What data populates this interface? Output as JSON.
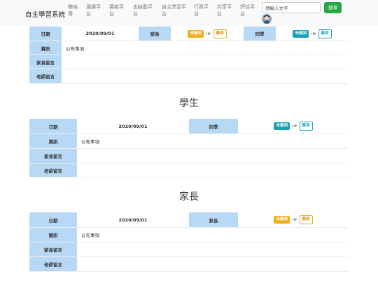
{
  "navbar": {
    "brand": "自主學習系統",
    "items": [
      {
        "line1": "聯絡",
        "line2": "簿"
      },
      {
        "line1": "選課平",
        "line2": "台"
      },
      {
        "line1": "募款平",
        "line2": "台"
      },
      {
        "line1": "出缺勤平",
        "line2": "台"
      },
      {
        "line1": "自主學習平",
        "line2": "台"
      },
      {
        "line1": "行政平",
        "line2": "台"
      },
      {
        "line1": "共享平",
        "line2": "台"
      },
      {
        "line1": "評估平",
        "line2": "台"
      }
    ],
    "search_placeholder": "請輸入文字",
    "search_button": "搜尋"
  },
  "top_block": {
    "date_label": "日期",
    "date_value": "2020/09/01",
    "parent_label": "家長",
    "parent_status": {
      "from": "未簽到",
      "to": "簽到"
    },
    "peer_label": "同學",
    "peer_status": {
      "from": "未簽到",
      "to": "簽到"
    },
    "info_label": "資訊",
    "info_value": "公布事項",
    "parent_msg_label": "家長留言",
    "teacher_msg_label": "老師留言"
  },
  "student_section": {
    "title": "學生",
    "date_label": "日期",
    "date_value": "2020/09/01",
    "peer_label": "同學",
    "peer_status": {
      "from": "未簽到",
      "to": "簽到"
    },
    "info_label": "資訊",
    "info_value": "公布事項",
    "parent_msg_label": "家長留言",
    "teacher_msg_label": "老師留言"
  },
  "parent_section": {
    "title": "家長",
    "date_label": "日期",
    "date_value": "2020/09/01",
    "parent_label": "家長",
    "parent_status": {
      "from": "未簽到",
      "to": "簽到"
    },
    "info_label": "資訊",
    "info_value": "公布事項",
    "parent_msg_label": "家長留言",
    "teacher_msg_label": "老師留言"
  },
  "arrow": "->",
  "colors": {
    "label_bg": "#b8d9f5",
    "search_btn": "#28a745",
    "orange": "#f0ad1c",
    "teal": "#17a2b8"
  }
}
